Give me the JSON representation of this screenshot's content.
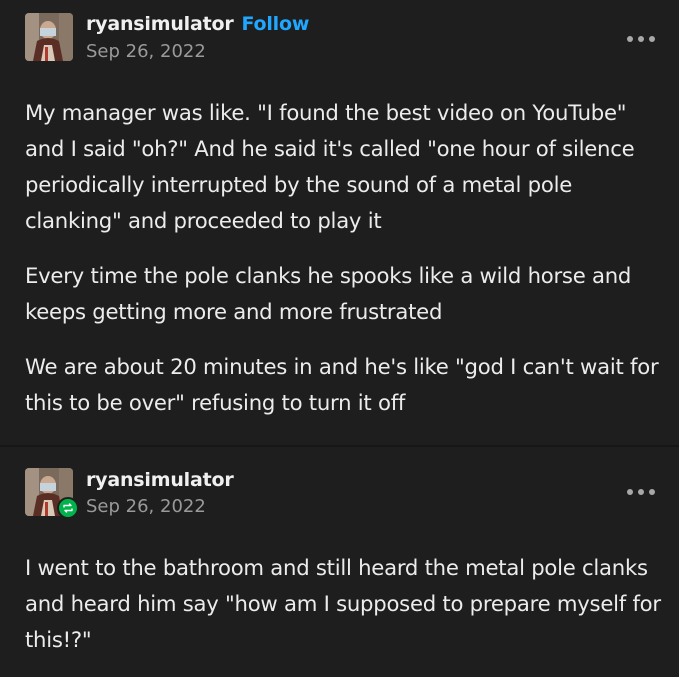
{
  "posts": [
    {
      "username": "ryansimulator",
      "follow_label": "Follow",
      "date": "Sep 26, 2022",
      "paragraphs": [
        "My manager was like. \"I found the best video on YouTube\" and I said \"oh?\" And he said it's called \"one hour of silence periodically interrupted by the sound of a metal pole clanking\" and proceeded to play it",
        "Every time the pole clanks he spooks like a wild horse and keeps getting more and more frustrated",
        "We are about 20 minutes in and he's like \"god I can't wait for this to be over\" refusing to turn it off"
      ]
    },
    {
      "username": "ryansimulator",
      "date": "Sep 26, 2022",
      "reblog_icon": "reblog-icon",
      "paragraphs": [
        "I went to the bathroom and still heard the metal pole clanks and heard him say \"how am I supposed to prepare myself for this!?\""
      ]
    }
  ],
  "colors": {
    "background": "#1e1e1e",
    "follow_accent": "#20a7ff",
    "reblog_badge": "#00b34a"
  }
}
